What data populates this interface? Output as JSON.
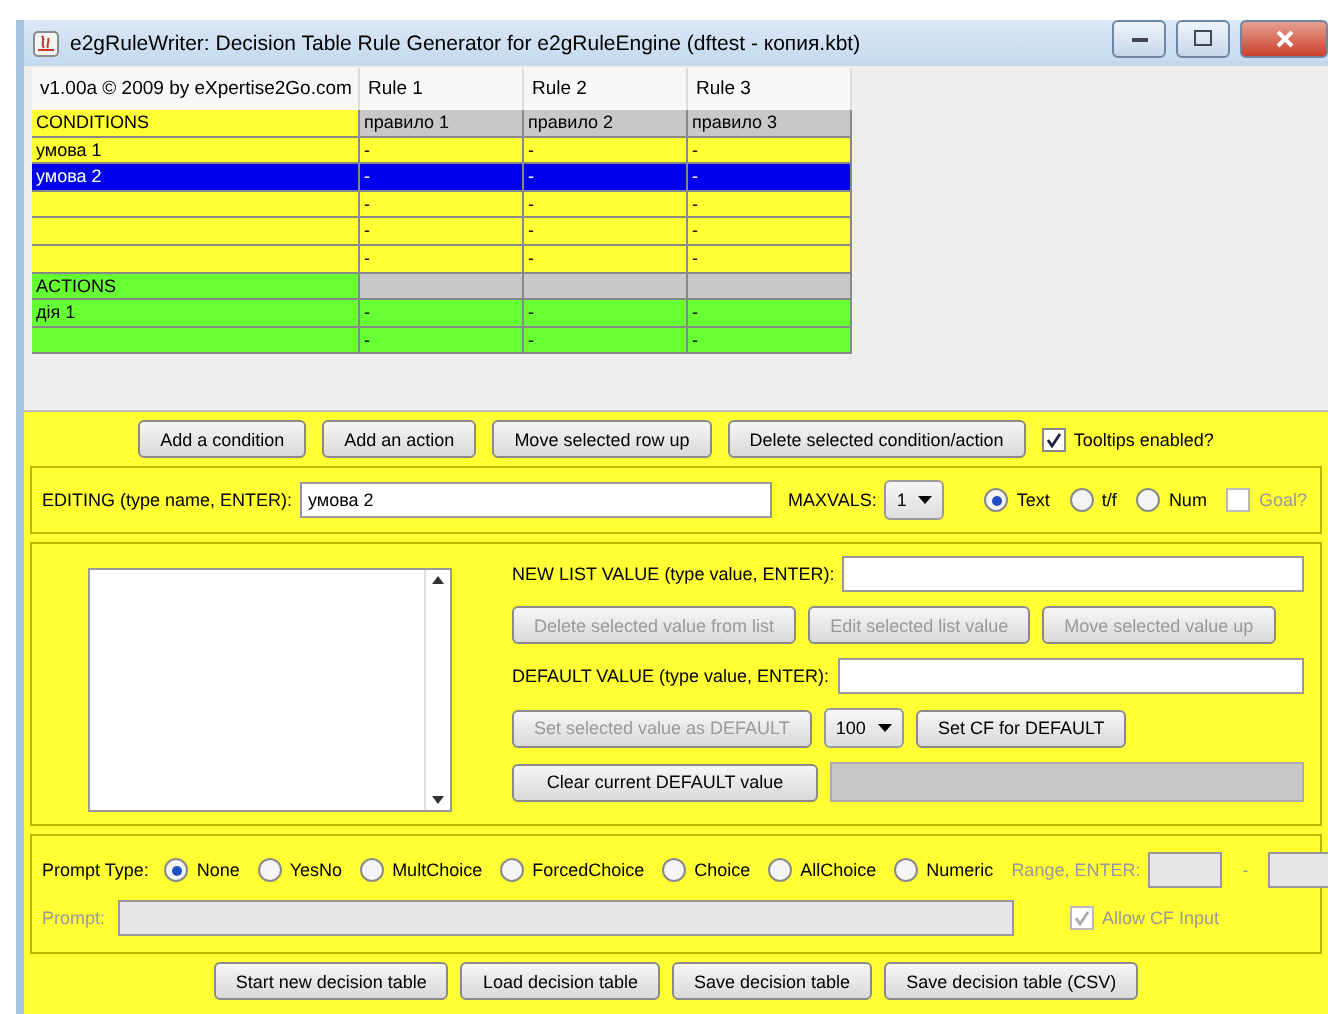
{
  "window": {
    "title": "e2gRuleWriter: Decision Table Rule Generator for e2gRuleEngine (dftest - копия.kbt)"
  },
  "table": {
    "columns": [
      "v1.00a © 2009 by eXpertise2Go.com",
      "Rule 1",
      "Rule 2",
      "Rule 3"
    ],
    "rows": [
      {
        "kind": "conditions_header",
        "name": "CONDITIONS",
        "selected": false,
        "cells": [
          "правило 1",
          "правило 2",
          "правило 3"
        ]
      },
      {
        "kind": "condition",
        "name": "умова 1",
        "selected": false,
        "cells": [
          "-",
          "-",
          "-"
        ]
      },
      {
        "kind": "condition",
        "name": "умова 2",
        "selected": true,
        "cells": [
          "-",
          "-",
          "-"
        ]
      },
      {
        "kind": "condition",
        "name": "",
        "selected": false,
        "cells": [
          "-",
          "-",
          "-"
        ]
      },
      {
        "kind": "condition",
        "name": "",
        "selected": false,
        "cells": [
          "-",
          "-",
          "-"
        ]
      },
      {
        "kind": "condition",
        "name": "",
        "selected": false,
        "cells": [
          "-",
          "-",
          "-"
        ]
      },
      {
        "kind": "actions_header",
        "name": "ACTIONS",
        "selected": false,
        "cells": [
          "",
          "",
          ""
        ]
      },
      {
        "kind": "action",
        "name": "дія 1",
        "selected": false,
        "cells": [
          "-",
          "-",
          "-"
        ]
      },
      {
        "kind": "action",
        "name": "",
        "selected": false,
        "cells": [
          "-",
          "-",
          "-"
        ]
      }
    ]
  },
  "toolbar": {
    "buttons": [
      "Add a condition",
      "Add an action",
      "Move selected row up",
      "Delete selected condition/action"
    ],
    "tooltips": {
      "label": "Tooltips enabled?",
      "checked": true
    }
  },
  "editing": {
    "label": "EDITING (type name, ENTER):",
    "value": "умова 2",
    "maxvals_label": "MAXVALS:",
    "maxvals": "1",
    "types": [
      {
        "label": "Text",
        "selected": true
      },
      {
        "label": "t/f",
        "selected": false
      },
      {
        "label": "Num",
        "selected": false
      }
    ],
    "goal": {
      "label": "Goal?",
      "checked": false,
      "disabled": true
    }
  },
  "values": {
    "new_label": "NEW LIST VALUE (type value, ENTER):",
    "list_buttons": [
      {
        "label": "Delete selected value from list",
        "disabled": true
      },
      {
        "label": "Edit selected list value",
        "disabled": true
      },
      {
        "label": "Move selected value up",
        "disabled": true
      }
    ],
    "default_label": "DEFAULT VALUE (type value, ENTER):",
    "set_default": {
      "label": "Set selected value as DEFAULT",
      "disabled": true
    },
    "cf": "100",
    "set_cf": {
      "label": "Set CF for DEFAULT",
      "disabled": false
    },
    "clear_default": {
      "label": "Clear current DEFAULT value",
      "disabled": false
    }
  },
  "prompt": {
    "type_label": "Prompt Type:",
    "types": [
      {
        "label": "None",
        "selected": true
      },
      {
        "label": "YesNo",
        "selected": false
      },
      {
        "label": "MultChoice",
        "selected": false
      },
      {
        "label": "ForcedChoice",
        "selected": false
      },
      {
        "label": "Choice",
        "selected": false
      },
      {
        "label": "AllChoice",
        "selected": false
      },
      {
        "label": "Numeric",
        "selected": false
      }
    ],
    "range_label": "Range, ENTER:",
    "range_sep": "-",
    "prompt_label": "Prompt:",
    "allow_cf": {
      "label": "Allow CF Input",
      "checked": true,
      "disabled": true
    }
  },
  "footer": {
    "buttons": [
      "Start new decision table",
      "Load decision table",
      "Save decision table",
      "Save decision table (CSV)"
    ]
  }
}
